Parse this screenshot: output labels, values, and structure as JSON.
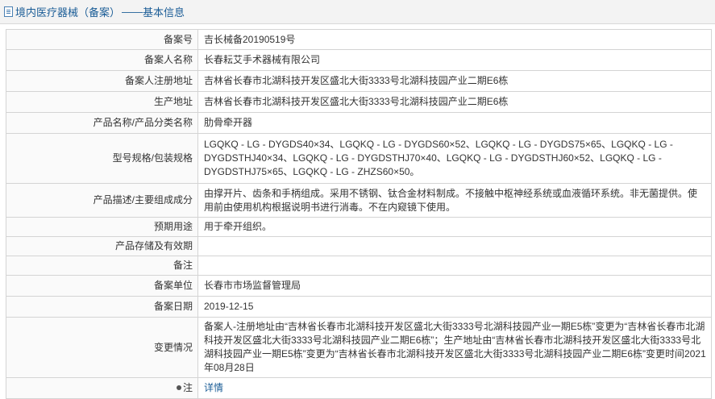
{
  "header": {
    "title": "境内医疗器械（备案）",
    "separator": "——",
    "subtitle": "基本信息"
  },
  "rows": [
    {
      "label": "备案号",
      "value": "吉长械备20190519号"
    },
    {
      "label": "备案人名称",
      "value": "长春耘艾手术器械有限公司"
    },
    {
      "label": "备案人注册地址",
      "value": "吉林省长春市北湖科技开发区盛北大街3333号北湖科技园产业二期E6栋"
    },
    {
      "label": "生产地址",
      "value": "吉林省长春市北湖科技开发区盛北大街3333号北湖科技园产业二期E6栋"
    },
    {
      "label": "产品名称/产品分类名称",
      "value": "肋骨牵开器"
    },
    {
      "label": "型号规格/包装规格",
      "value": "LGQKQ - LG - DYGDS40×34、LGQKQ - LG - DYGDS60×52、LGQKQ - LG - DYGDS75×65、LGQKQ - LG - DYGDSTHJ40×34、LGQKQ - LG - DYGDSTHJ70×40、LGQKQ - LG - DYGDSTHJ60×52、LGQKQ - LG - DYGDSTHJ75×65、LGQKQ - LG - ZHZS60×50。"
    },
    {
      "label": "产品描述/主要组成成分",
      "value": "由撑开片、齿条和手柄组成。采用不锈钢、钛合金材料制成。不接触中枢神经系统或血液循环系统。非无菌提供。使用前由使用机构根据说明书进行消毒。不在内窥镜下使用。"
    },
    {
      "label": "预期用途",
      "value": "用于牵开组织。"
    },
    {
      "label": "产品存储及有效期",
      "value": ""
    },
    {
      "label": "备注",
      "value": ""
    },
    {
      "label": "备案单位",
      "value": "长春市市场监督管理局"
    },
    {
      "label": "备案日期",
      "value": "2019-12-15"
    },
    {
      "label": "变更情况",
      "value": "备案人-注册地址由“吉林省长春市北湖科技开发区盛北大街3333号北湖科技园产业一期E5栋”变更为“吉林省长春市北湖科技开发区盛北大街3333号北湖科技园产业二期E6栋”；生产地址由“吉林省长春市北湖科技开发区盛北大街3333号北湖科技园产业一期E5栋”变更为“吉林省长春市北湖科技开发区盛北大街3333号北湖科技园产业二期E6栋”变更时间2021年08月28日"
    },
    {
      "label": "注",
      "value": "详情"
    }
  ]
}
